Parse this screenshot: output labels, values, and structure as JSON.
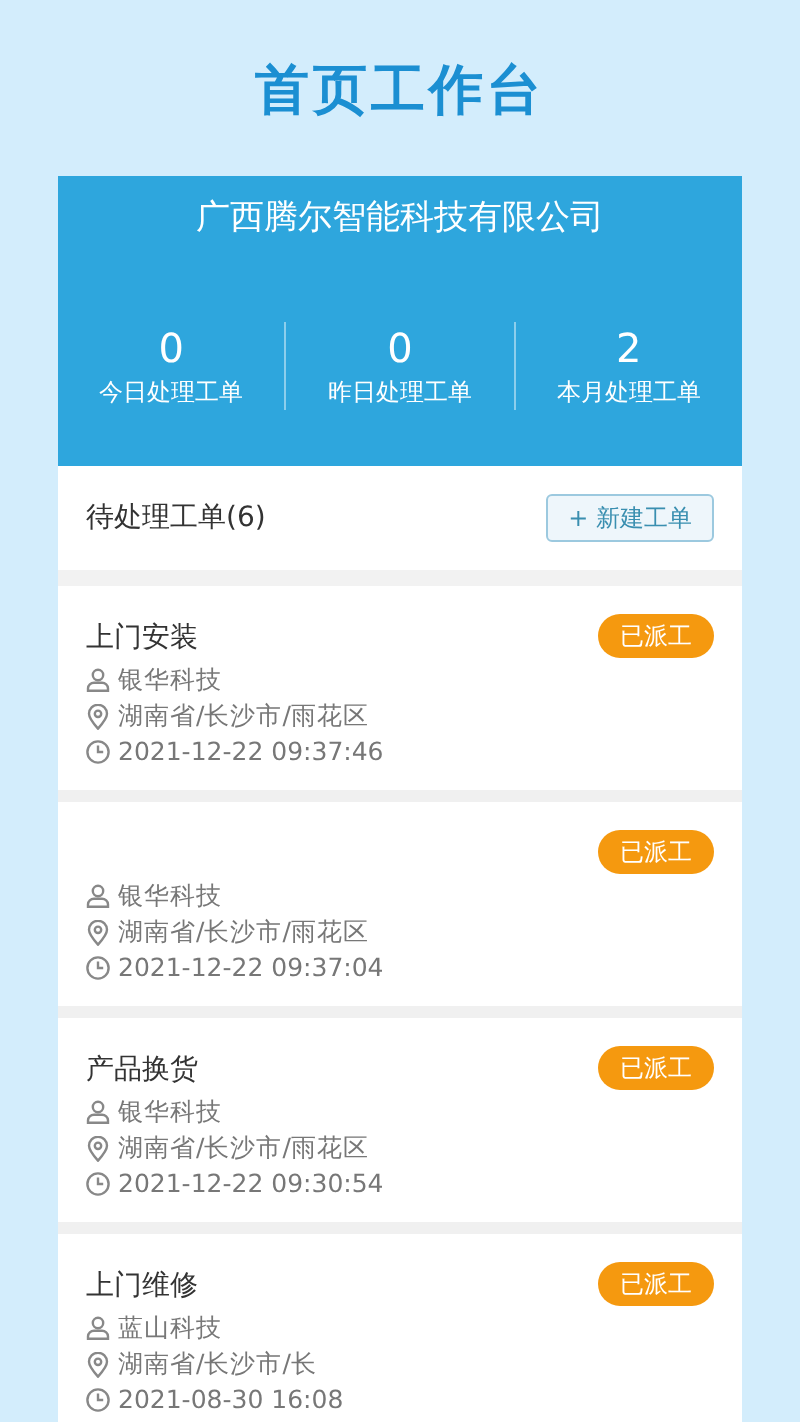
{
  "page_title": "首页工作台",
  "company": "广西腾尔智能科技有限公司",
  "stats": [
    {
      "value": "0",
      "label": "今日处理工单"
    },
    {
      "value": "0",
      "label": "昨日处理工单"
    },
    {
      "value": "2",
      "label": "本月处理工单"
    }
  ],
  "pending": {
    "title": "待处理工单(6)",
    "new_button": "+ 新建工单"
  },
  "orders": [
    {
      "title": "上门安装",
      "status": "已派工",
      "customer": "银华科技",
      "address": "湖南省/长沙市/雨花区",
      "time": "2021-12-22 09:37:46"
    },
    {
      "status": "已派工",
      "customer": "银华科技",
      "address": "湖南省/长沙市/雨花区",
      "time": "2021-12-22 09:37:04"
    },
    {
      "title": "产品换货",
      "status": "已派工",
      "customer": "银华科技",
      "address": "湖南省/长沙市/雨花区",
      "time": "2021-12-22 09:30:54"
    },
    {
      "title": "上门维修",
      "status": "已派工",
      "customer": "蓝山科技",
      "address": "湖南省/长沙市/长",
      "time": "2021-08-30 16:08"
    }
  ]
}
